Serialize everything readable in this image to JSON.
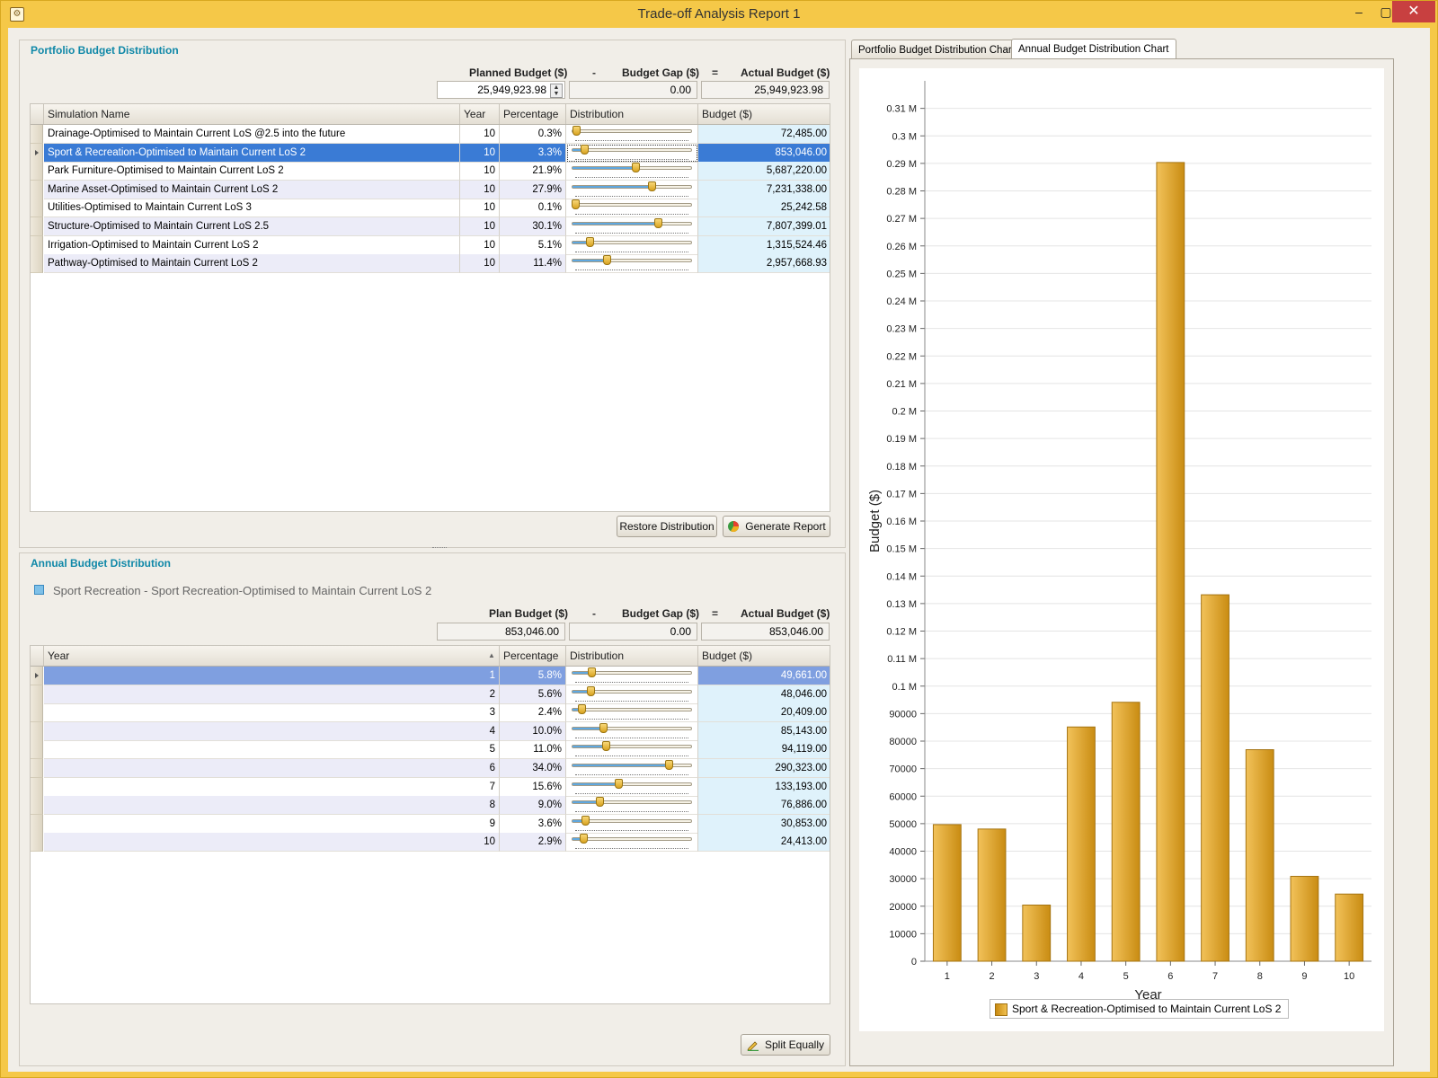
{
  "window": {
    "title": "Trade-off Analysis Report 1",
    "min": "–",
    "max": "▢",
    "close": "✕"
  },
  "portfolio": {
    "title": "Portfolio Budget Distribution",
    "planned_label": "Planned Budget ($)",
    "minus": "-",
    "gap_label": "Budget Gap ($)",
    "equals": "=",
    "actual_label": "Actual Budget ($)",
    "planned_value": "25,949,923.98",
    "gap_value": "0.00",
    "actual_value": "25,949,923.98",
    "columns": [
      "Simulation Name",
      "Year",
      "Percentage",
      "Distribution",
      "Budget ($)"
    ],
    "rows": [
      {
        "name": "Drainage-Optimised to Maintain Current LoS @2.5 into the future",
        "year": "10",
        "pct": "0.3%",
        "level": 0.003,
        "budget": "72,485.00"
      },
      {
        "name": "Sport & Recreation-Optimised to Maintain Current LoS 2",
        "year": "10",
        "pct": "3.3%",
        "level": 0.033,
        "budget": "853,046.00"
      },
      {
        "name": "Park Furniture-Optimised to Maintain Current LoS 2",
        "year": "10",
        "pct": "21.9%",
        "level": 0.219,
        "budget": "5,687,220.00"
      },
      {
        "name": "Marine Asset-Optimised to Maintain Current LoS 2",
        "year": "10",
        "pct": "27.9%",
        "level": 0.279,
        "budget": "7,231,338.00"
      },
      {
        "name": "Utilities-Optimised to Maintain Current LoS 3",
        "year": "10",
        "pct": "0.1%",
        "level": 0.001,
        "budget": "25,242.58"
      },
      {
        "name": "Structure-Optimised to Maintain Current LoS 2.5",
        "year": "10",
        "pct": "30.1%",
        "level": 0.301,
        "budget": "7,807,399.01"
      },
      {
        "name": "Irrigation-Optimised to Maintain Current LoS 2",
        "year": "10",
        "pct": "5.1%",
        "level": 0.051,
        "budget": "1,315,524.46"
      },
      {
        "name": "Pathway-Optimised to Maintain Current LoS 2",
        "year": "10",
        "pct": "11.4%",
        "level": 0.114,
        "budget": "2,957,668.93"
      }
    ],
    "restore_label": "Restore Distribution",
    "generate_label": "Generate Report"
  },
  "annual": {
    "title": "Annual Budget Distribution",
    "subtitle": "Sport  Recreation - Sport  Recreation-Optimised to Maintain Current LoS 2",
    "plan_label": "Plan Budget ($)",
    "minus": "-",
    "gap_label": "Budget Gap ($)",
    "equals": "=",
    "actual_label": "Actual Budget ($)",
    "plan_value": "853,046.00",
    "gap_value": "0.00",
    "actual_value": "853,046.00",
    "columns": [
      "Year",
      "Percentage",
      "Distribution",
      "Budget ($)"
    ],
    "rows": [
      {
        "year": "1",
        "pct": "5.8%",
        "level": 0.058,
        "budget": "49,661.00"
      },
      {
        "year": "2",
        "pct": "5.6%",
        "level": 0.056,
        "budget": "48,046.00"
      },
      {
        "year": "3",
        "pct": "2.4%",
        "level": 0.024,
        "budget": "20,409.00"
      },
      {
        "year": "4",
        "pct": "10.0%",
        "level": 0.1,
        "budget": "85,143.00"
      },
      {
        "year": "5",
        "pct": "11.0%",
        "level": 0.11,
        "budget": "94,119.00"
      },
      {
        "year": "6",
        "pct": "34.0%",
        "level": 0.34,
        "budget": "290,323.00"
      },
      {
        "year": "7",
        "pct": "15.6%",
        "level": 0.156,
        "budget": "133,193.00"
      },
      {
        "year": "8",
        "pct": "9.0%",
        "level": 0.09,
        "budget": "76,886.00"
      },
      {
        "year": "9",
        "pct": "3.6%",
        "level": 0.036,
        "budget": "30,853.00"
      },
      {
        "year": "10",
        "pct": "2.9%",
        "level": 0.029,
        "budget": "24,413.00"
      }
    ],
    "split_label": "Split Equally"
  },
  "tabs": [
    "Portfolio Budget Distribution Chart",
    "Annual Budget Distribution Chart"
  ],
  "chart_data": {
    "type": "bar",
    "categories": [
      "1",
      "2",
      "3",
      "4",
      "5",
      "6",
      "7",
      "8",
      "9",
      "10"
    ],
    "series": [
      {
        "name": "Sport & Recreation-Optimised to Maintain Current LoS 2",
        "values": [
          49661,
          48046,
          20409,
          85143,
          94119,
          290323,
          133193,
          76886,
          30853,
          24413
        ]
      }
    ],
    "xlabel": "Year",
    "ylabel": "Budget ($)",
    "ylim": [
      0,
      320000
    ],
    "yticks": [
      "0",
      "10000",
      "20000",
      "30000",
      "40000",
      "50000",
      "60000",
      "70000",
      "80000",
      "90000",
      "0.1 M",
      "0.11 M",
      "0.12 M",
      "0.13 M",
      "0.14 M",
      "0.15 M",
      "0.16 M",
      "0.17 M",
      "0.18 M",
      "0.19 M",
      "0.2 M",
      "0.21 M",
      "0.22 M",
      "0.23 M",
      "0.24 M",
      "0.25 M",
      "0.26 M",
      "0.27 M",
      "0.28 M",
      "0.29 M",
      "0.3 M",
      "0.31 M"
    ],
    "grid": true,
    "legend": "bottom",
    "bar_color": "#e0a830"
  }
}
